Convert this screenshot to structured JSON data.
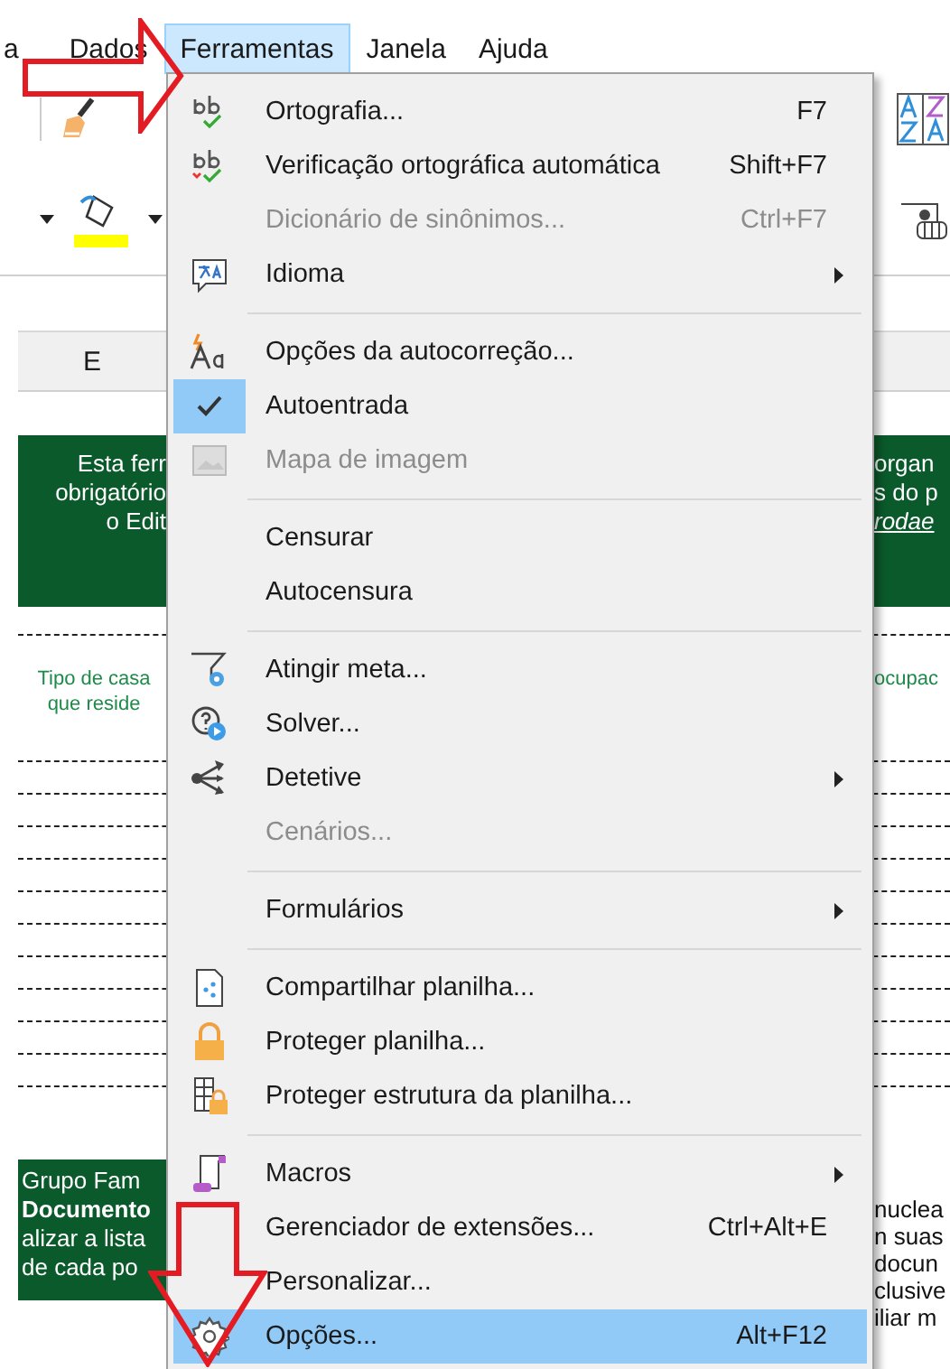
{
  "menubar": [
    {
      "label": "a",
      "selected": false
    },
    {
      "label": "Dados",
      "selected": false
    },
    {
      "label": "Ferramentas",
      "selected": true
    },
    {
      "label": "Janela",
      "selected": false
    },
    {
      "label": "Ajuda",
      "selected": false
    }
  ],
  "column_header": "E",
  "banner_top": {
    "left": [
      "Esta ferr",
      "obrigatório",
      "o Edit"
    ],
    "right": [
      {
        "text": "organ",
        "link": false
      },
      {
        "text": "s do p",
        "link": false
      },
      {
        "text": "rodae",
        "link": true
      }
    ]
  },
  "table_header": {
    "left": "Tipo de casa que reside",
    "right": "ocupac"
  },
  "banner_bottom": {
    "left": [
      {
        "text": "Grupo Fam",
        "bold": false
      },
      {
        "text": "Documento",
        "bold": true
      },
      {
        "text": "alizar a lista",
        "bold": false
      },
      {
        "text": "de cada po",
        "bold": false
      }
    ],
    "right": [
      "nuclea",
      "n suas",
      "docun",
      "clusive",
      "iliar m"
    ]
  },
  "menu": {
    "items": [
      {
        "kind": "item",
        "label": "Ortografia...",
        "shortcut": "F7",
        "disabled": false,
        "checked": false,
        "selected": false,
        "submenu": false
      },
      {
        "kind": "item",
        "label": "Verificação ortográfica automática",
        "shortcut": "Shift+F7",
        "disabled": false,
        "checked": false,
        "selected": false,
        "submenu": false
      },
      {
        "kind": "item",
        "label": "Dicionário de sinônimos...",
        "shortcut": "Ctrl+F7",
        "disabled": true,
        "checked": false,
        "selected": false,
        "submenu": false
      },
      {
        "kind": "item",
        "label": "Idioma",
        "disabled": false,
        "checked": false,
        "selected": false,
        "submenu": true
      },
      {
        "kind": "separator"
      },
      {
        "kind": "item",
        "label": "Opções da autocorreção...",
        "disabled": false,
        "checked": false,
        "selected": false,
        "submenu": false
      },
      {
        "kind": "item",
        "label": "Autoentrada",
        "disabled": false,
        "checked": true,
        "selected": false,
        "submenu": false
      },
      {
        "kind": "item",
        "label": "Mapa de imagem",
        "disabled": true,
        "checked": false,
        "selected": false,
        "submenu": false
      },
      {
        "kind": "separator"
      },
      {
        "kind": "item",
        "label": "Censurar",
        "disabled": false,
        "checked": false,
        "selected": false,
        "submenu": false
      },
      {
        "kind": "item",
        "label": "Autocensura",
        "disabled": false,
        "checked": false,
        "selected": false,
        "submenu": false
      },
      {
        "kind": "separator"
      },
      {
        "kind": "item",
        "label": "Atingir meta...",
        "disabled": false,
        "checked": false,
        "selected": false,
        "submenu": false
      },
      {
        "kind": "item",
        "label": "Solver...",
        "disabled": false,
        "checked": false,
        "selected": false,
        "submenu": false
      },
      {
        "kind": "item",
        "label": "Detetive",
        "disabled": false,
        "checked": false,
        "selected": false,
        "submenu": true
      },
      {
        "kind": "item",
        "label": "Cenários...",
        "disabled": true,
        "checked": false,
        "selected": false,
        "submenu": false
      },
      {
        "kind": "separator"
      },
      {
        "kind": "item",
        "label": "Formulários",
        "disabled": false,
        "checked": false,
        "selected": false,
        "submenu": true
      },
      {
        "kind": "separator"
      },
      {
        "kind": "item",
        "label": "Compartilhar planilha...",
        "disabled": false,
        "checked": false,
        "selected": false,
        "submenu": false
      },
      {
        "kind": "item",
        "label": "Proteger planilha...",
        "disabled": false,
        "checked": false,
        "selected": false,
        "submenu": false
      },
      {
        "kind": "item",
        "label": "Proteger estrutura da planilha...",
        "disabled": false,
        "checked": false,
        "selected": false,
        "submenu": false
      },
      {
        "kind": "separator"
      },
      {
        "kind": "item",
        "label": "Macros",
        "disabled": false,
        "checked": false,
        "selected": false,
        "submenu": true
      },
      {
        "kind": "item",
        "label": "Gerenciador de extensões...",
        "shortcut": "Ctrl+Alt+E",
        "disabled": false,
        "checked": false,
        "selected": false,
        "submenu": false
      },
      {
        "kind": "item",
        "label": "Personalizar...",
        "disabled": false,
        "checked": false,
        "selected": false,
        "submenu": false
      },
      {
        "kind": "item",
        "label": "Opções...",
        "shortcut": "Alt+F12",
        "disabled": false,
        "checked": false,
        "selected": true,
        "submenu": false
      }
    ]
  }
}
